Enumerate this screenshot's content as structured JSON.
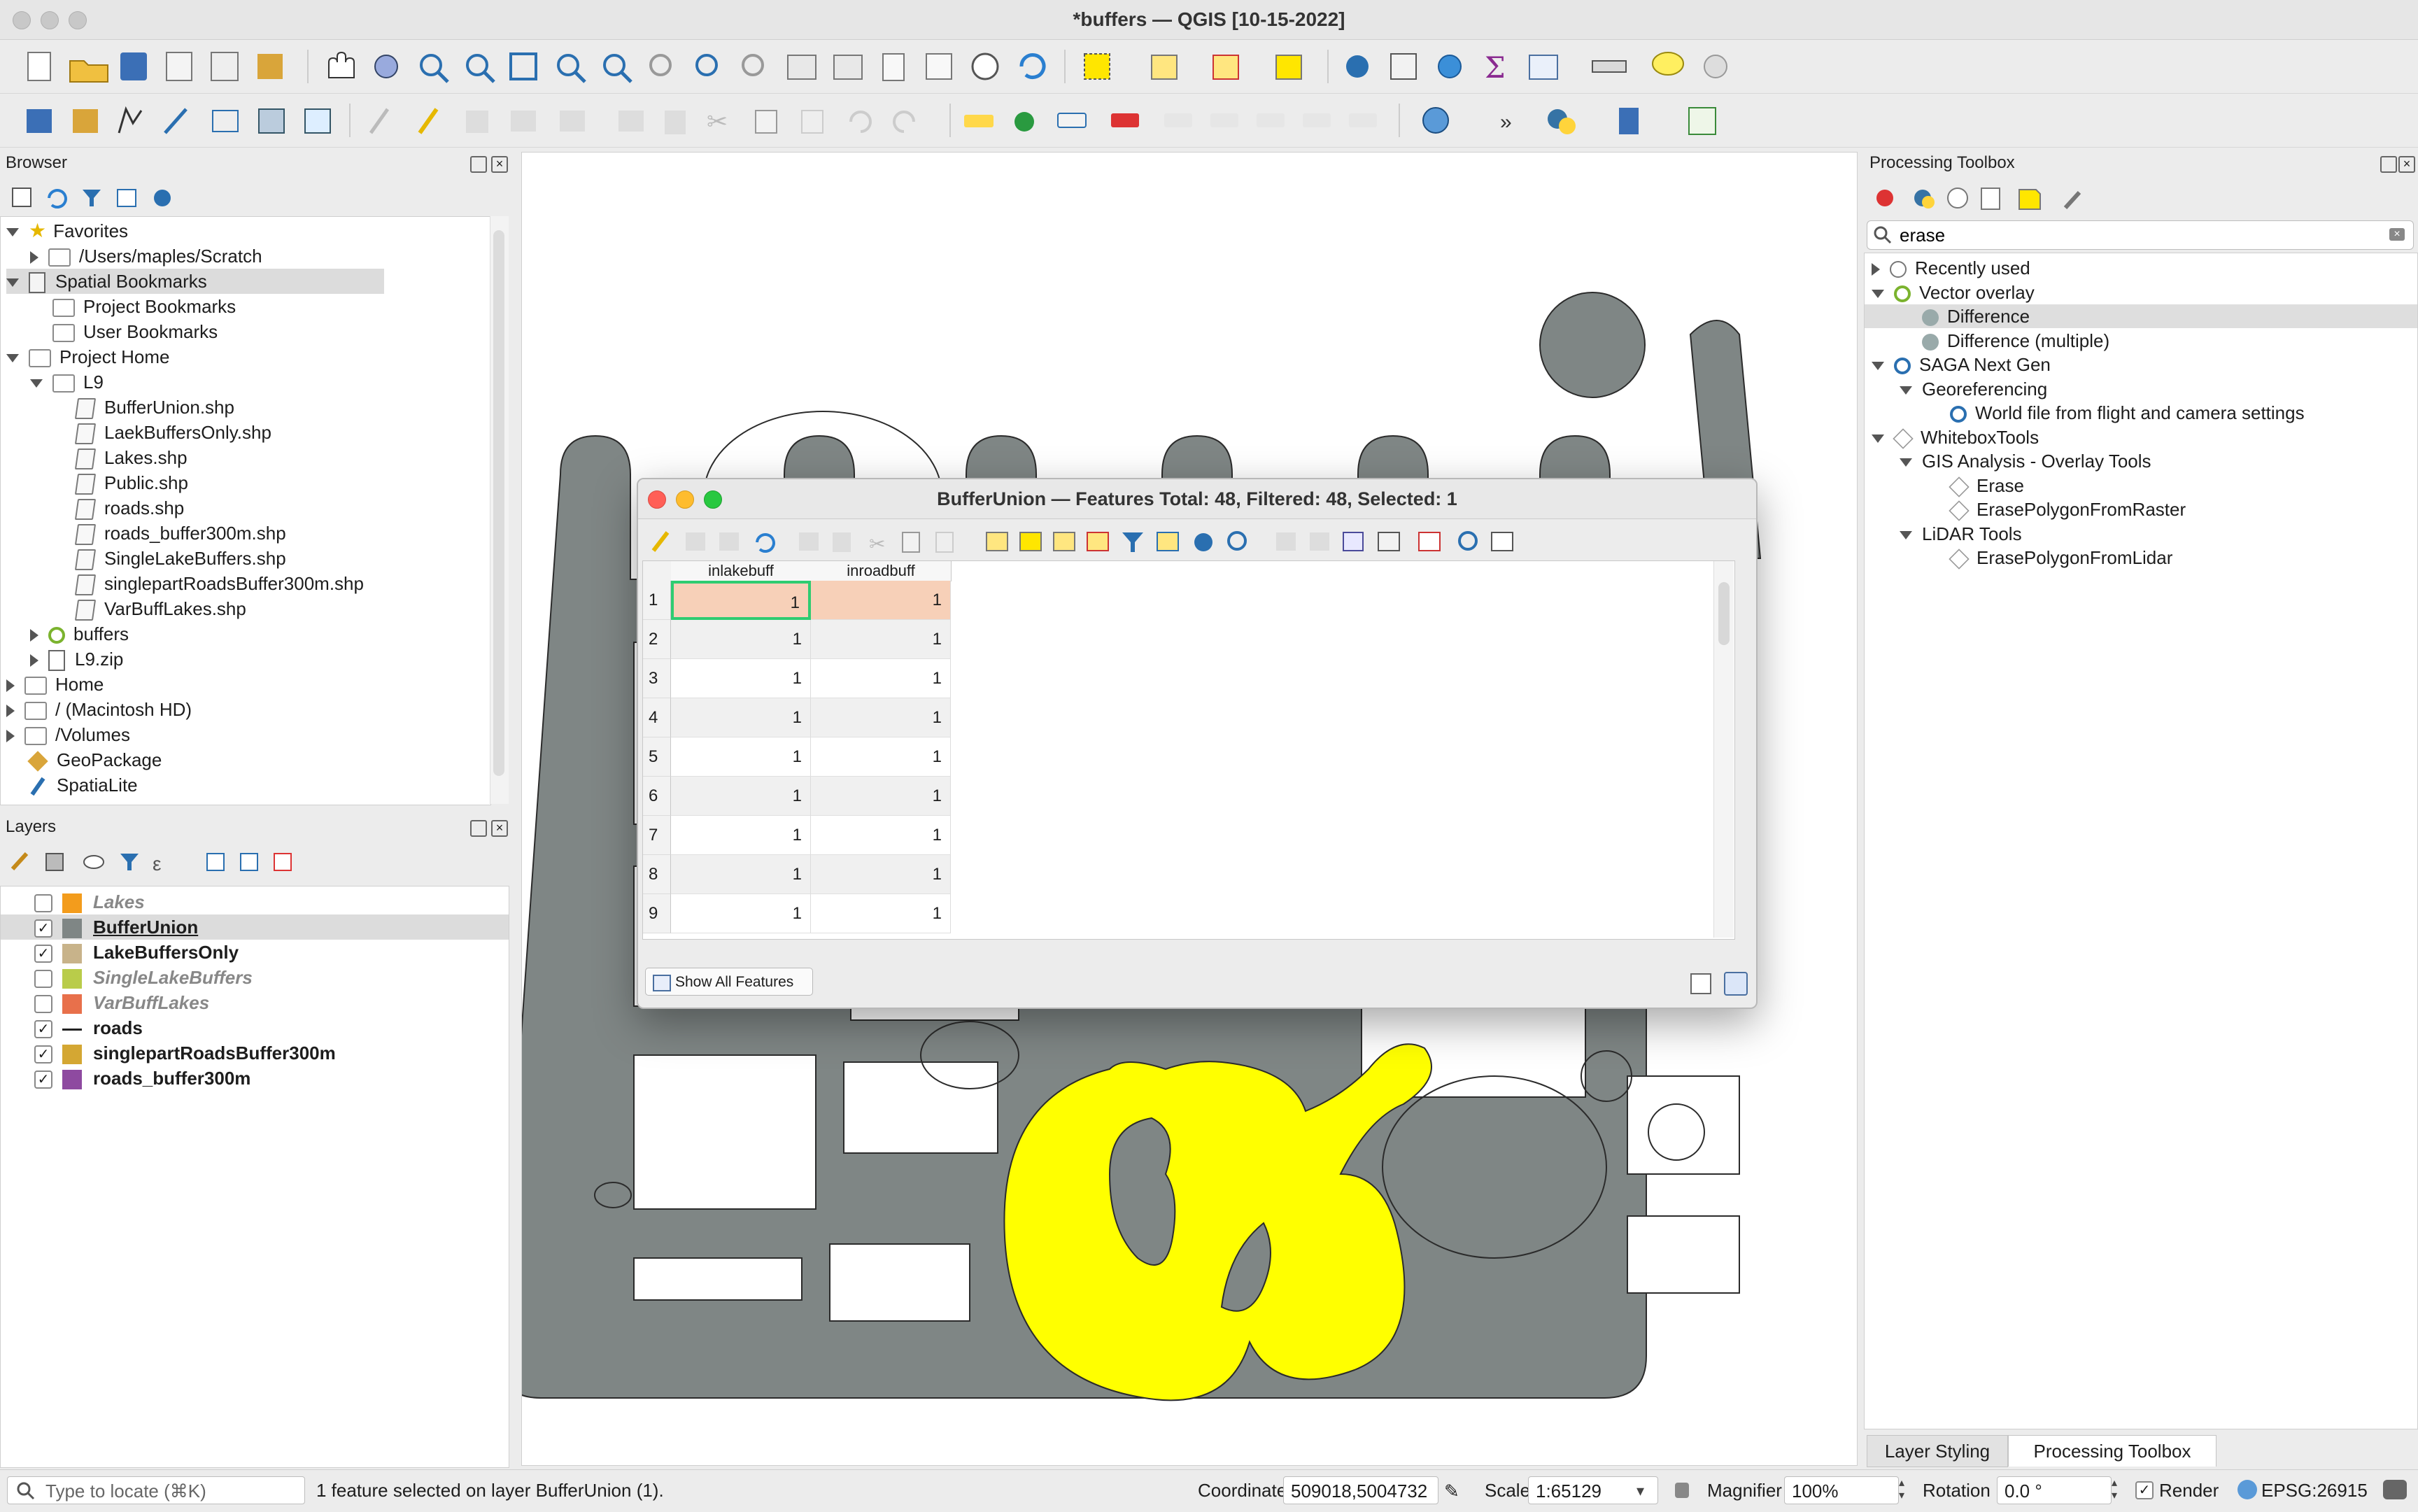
{
  "window": {
    "title": "*buffers — QGIS [10-15-2022]"
  },
  "browser": {
    "title": "Browser",
    "items": [
      {
        "label": "Favorites",
        "kind": "star",
        "expanded": true,
        "depth": 0
      },
      {
        "label": "/Users/maples/Scratch",
        "kind": "folder",
        "expanded": false,
        "depth": 1
      },
      {
        "label": "Spatial Bookmarks",
        "kind": "bookmark",
        "expanded": true,
        "depth": 0,
        "selected": true
      },
      {
        "label": "Project Bookmarks",
        "kind": "folder",
        "depth": 1
      },
      {
        "label": "User Bookmarks",
        "kind": "folder",
        "depth": 1
      },
      {
        "label": "Project Home",
        "kind": "folder",
        "expanded": true,
        "depth": 0
      },
      {
        "label": "L9",
        "kind": "folder",
        "expanded": true,
        "depth": 1
      },
      {
        "label": "BufferUnion.shp",
        "kind": "shp",
        "depth": 2
      },
      {
        "label": "LaekBuffersOnly.shp",
        "kind": "shp",
        "depth": 2
      },
      {
        "label": "Lakes.shp",
        "kind": "shp",
        "depth": 2
      },
      {
        "label": "Public.shp",
        "kind": "shp",
        "depth": 2
      },
      {
        "label": "roads.shp",
        "kind": "shp",
        "depth": 2
      },
      {
        "label": "roads_buffer300m.shp",
        "kind": "shp",
        "depth": 2
      },
      {
        "label": "SingleLakeBuffers.shp",
        "kind": "shp",
        "depth": 2
      },
      {
        "label": "singlepartRoadsBuffer300m.shp",
        "kind": "shp",
        "depth": 2
      },
      {
        "label": "VarBuffLakes.shp",
        "kind": "shp",
        "depth": 2
      },
      {
        "label": "buffers",
        "kind": "qgis",
        "expanded": false,
        "depth": 1
      },
      {
        "label": "L9.zip",
        "kind": "zip",
        "expanded": false,
        "depth": 1
      },
      {
        "label": "Home",
        "kind": "folder",
        "expanded": false,
        "depth": 0
      },
      {
        "label": "/ (Macintosh HD)",
        "kind": "folder",
        "expanded": false,
        "depth": 0
      },
      {
        "label": "/Volumes",
        "kind": "folder",
        "expanded": false,
        "depth": 0
      },
      {
        "label": "GeoPackage",
        "kind": "gpkg",
        "depth": 0
      },
      {
        "label": "SpatiaLite",
        "kind": "spatialite",
        "depth": 0
      }
    ]
  },
  "layers": {
    "title": "Layers",
    "items": [
      {
        "label": "Lakes",
        "checked": false,
        "color": "#f39c1c",
        "italic": true
      },
      {
        "label": "BufferUnion",
        "checked": true,
        "color": "#7f8685",
        "underline": true,
        "selected": true
      },
      {
        "label": "LakeBuffersOnly",
        "checked": true,
        "color": "#c8b38a"
      },
      {
        "label": "SingleLakeBuffers",
        "checked": false,
        "color": "#b9cc4a",
        "italic": true
      },
      {
        "label": "VarBuffLakes",
        "checked": false,
        "color": "#e8704b",
        "italic": true
      },
      {
        "label": "roads",
        "checked": true,
        "color": "#222222",
        "line": true
      },
      {
        "label": "singlepartRoadsBuffer300m",
        "checked": true,
        "color": "#d4a733"
      },
      {
        "label": "roads_buffer300m",
        "checked": true,
        "color": "#8e4aa0"
      }
    ]
  },
  "attribute_table": {
    "title": "BufferUnion — Features Total: 48, Filtered: 48, Selected: 1",
    "columns": [
      "inlakebuff",
      "inroadbuff"
    ],
    "rows": [
      [
        "1",
        "1",
        "1"
      ],
      [
        "2",
        "1",
        "1"
      ],
      [
        "3",
        "1",
        "1"
      ],
      [
        "4",
        "1",
        "1"
      ],
      [
        "5",
        "1",
        "1"
      ],
      [
        "6",
        "1",
        "1"
      ],
      [
        "7",
        "1",
        "1"
      ],
      [
        "8",
        "1",
        "1"
      ],
      [
        "9",
        "1",
        "1"
      ]
    ],
    "filter_button": "Show All Features"
  },
  "processing": {
    "title": "Processing Toolbox",
    "search_value": "erase",
    "tree": [
      {
        "label": "Recently used",
        "depth": 0,
        "arrow": "right",
        "icon": "clock"
      },
      {
        "label": "Vector overlay",
        "depth": 0,
        "arrow": "down",
        "icon": "qgis"
      },
      {
        "label": "Difference",
        "depth": 1,
        "icon": "alg",
        "selected": true
      },
      {
        "label": "Difference (multiple)",
        "depth": 1,
        "icon": "alg"
      },
      {
        "label": "SAGA Next Gen",
        "depth": 0,
        "arrow": "down",
        "icon": "saga"
      },
      {
        "label": "Georeferencing",
        "depth": 1,
        "arrow": "down"
      },
      {
        "label": "World file from flight and camera settings",
        "depth": 2,
        "icon": "saga"
      },
      {
        "label": "WhiteboxTools",
        "depth": 0,
        "arrow": "down",
        "icon": "wbt"
      },
      {
        "label": "GIS Analysis - Overlay Tools",
        "depth": 1,
        "arrow": "down"
      },
      {
        "label": "Erase",
        "depth": 2,
        "icon": "wbt"
      },
      {
        "label": "ErasePolygonFromRaster",
        "depth": 2,
        "icon": "wbt"
      },
      {
        "label": "LiDAR Tools",
        "depth": 1,
        "arrow": "down"
      },
      {
        "label": "ErasePolygonFromLidar",
        "depth": 2,
        "icon": "wbt"
      }
    ],
    "tabs": [
      "Layer Styling",
      "Processing Toolbox"
    ]
  },
  "status": {
    "locate_placeholder": "Type to locate (⌘K)",
    "message": "1 feature selected on layer BufferUnion (1).",
    "coordinate_label": "Coordinate",
    "coordinate_value": "509018,5004732",
    "scale_label": "Scale",
    "scale_value": "1:65129",
    "magnifier_label": "Magnifier",
    "magnifier_value": "100%",
    "rotation_label": "Rotation",
    "rotation_value": "0.0 °",
    "render_label": "Render",
    "crs": "EPSG:26915"
  },
  "colors": {
    "buffer_fill": "#7f8685",
    "selection": "#ffff00",
    "accent_selected": "#2ecc71"
  }
}
